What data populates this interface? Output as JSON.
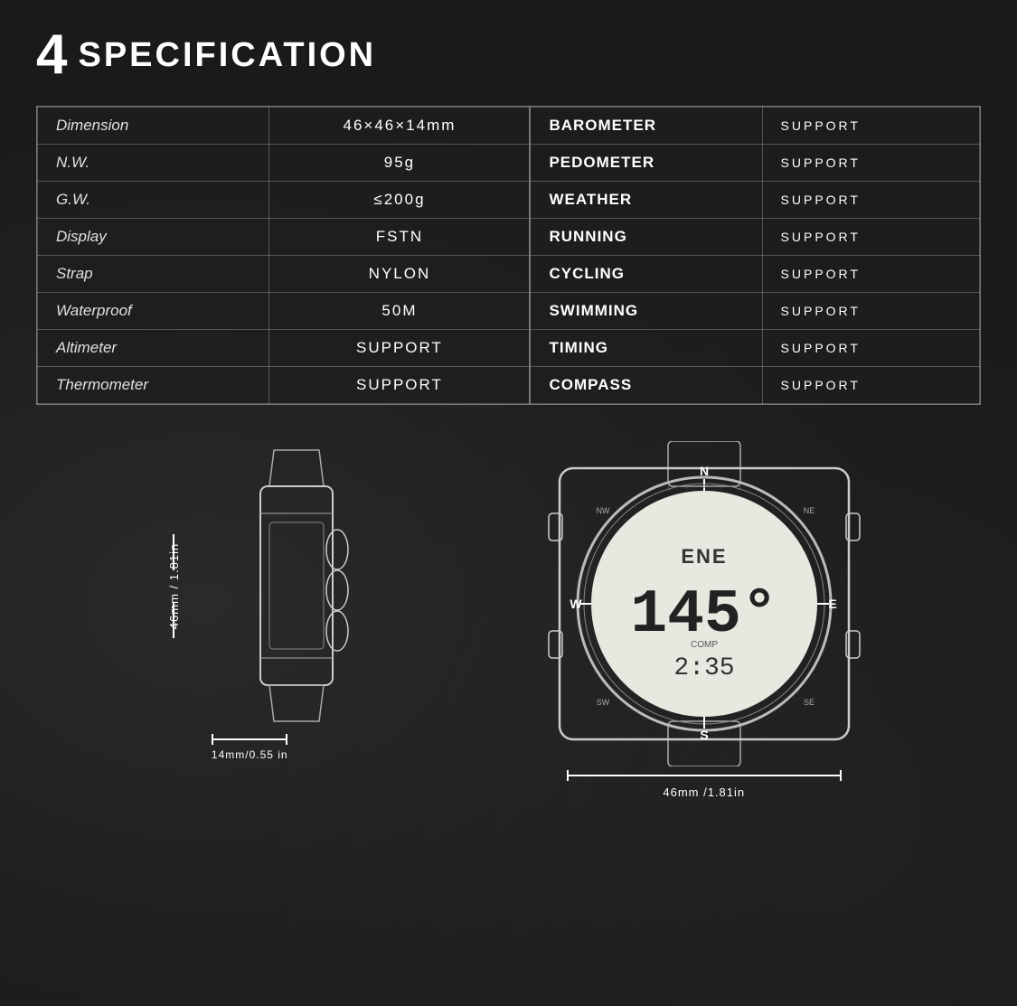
{
  "title": {
    "number": "4",
    "text": "SPECIFICATION"
  },
  "spec_table": {
    "left_rows": [
      {
        "label": "Dimension",
        "value": "46×46×14mm"
      },
      {
        "label": "N.W.",
        "value": "95g"
      },
      {
        "label": "G.W.",
        "value": "≤200g"
      },
      {
        "label": "Display",
        "value": "FSTN"
      },
      {
        "label": "Strap",
        "value": "NYLON"
      },
      {
        "label": "Waterproof",
        "value": "50M"
      },
      {
        "label": "Altimeter",
        "value": "SUPPORT"
      },
      {
        "label": "Thermometer",
        "value": "SUPPORT"
      }
    ],
    "right_rows": [
      {
        "label": "Barometer",
        "value": "SUPPORT"
      },
      {
        "label": "Pedometer",
        "value": "SUPPORT"
      },
      {
        "label": "Weather",
        "value": "SUPPORT"
      },
      {
        "label": "RUNNING",
        "value": "SUPPORT"
      },
      {
        "label": "CYCLING",
        "value": "SUPPORT"
      },
      {
        "label": "SWIMMING",
        "value": "SUPPORT"
      },
      {
        "label": "TIMING",
        "value": "SUPPORT"
      },
      {
        "label": "COMPASS",
        "value": "SUPPORT"
      }
    ]
  },
  "diagrams": {
    "side_dimension_vertical": "46mm / 1.81in",
    "side_dimension_horizontal": "14mm/0.55 in",
    "front_dimension": "46mm /1.81in",
    "watch_display": {
      "direction": "ENE",
      "degrees": "145°",
      "label": "COMP",
      "time": "2:35"
    }
  }
}
